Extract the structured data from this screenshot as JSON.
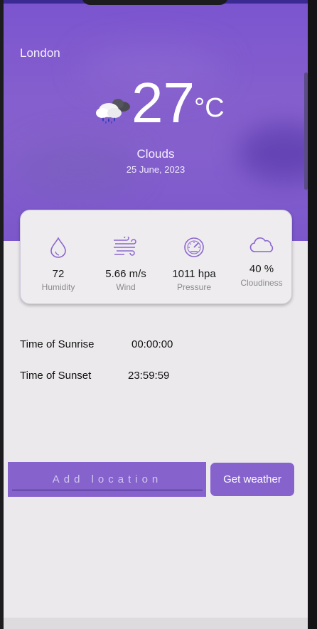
{
  "city": "London",
  "current": {
    "temperature": "27",
    "unit": "°C",
    "condition": "Clouds",
    "date": "25 June, 2023",
    "icon": "cloud-rain-icon"
  },
  "stats": [
    {
      "value": "72",
      "label": "Humidity",
      "icon": "droplet-icon"
    },
    {
      "value": "5.66 m/s",
      "label": "Wind",
      "icon": "wind-icon"
    },
    {
      "value": "1011 hpa",
      "label": "Pressure",
      "icon": "gauge-icon"
    },
    {
      "value": "40 %",
      "label": "Cloudiness",
      "icon": "cloud-icon"
    }
  ],
  "sun": {
    "sunrise_label": "Time of Sunrise",
    "sunrise_value": "00:00:00",
    "sunset_label": "Time of Sunset",
    "sunset_value": "23:59:59"
  },
  "form": {
    "placeholder": "Add location",
    "button_label": "Get weather"
  },
  "colors": {
    "accent": "#8662cd",
    "header_gradient": "#7b55cf",
    "background": "#ece9ec"
  }
}
